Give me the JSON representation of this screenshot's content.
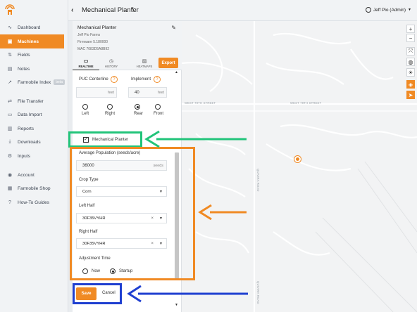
{
  "sidebar": {
    "items": [
      {
        "label": "Dashboard",
        "icon": "pulse-icon"
      },
      {
        "label": "Machines",
        "icon": "machine-icon",
        "active": true
      },
      {
        "label": "Fields",
        "icon": "field-icon"
      },
      {
        "label": "Notes",
        "icon": "notes-icon"
      },
      {
        "label": "Farmobile Index",
        "icon": "index-icon",
        "badge": "beta"
      },
      {
        "label": "File Transfer",
        "icon": "transfer-icon"
      },
      {
        "label": "Data Import",
        "icon": "import-icon"
      },
      {
        "label": "Reports",
        "icon": "reports-icon"
      },
      {
        "label": "Downloads",
        "icon": "download-icon"
      },
      {
        "label": "Inputs",
        "icon": "inputs-icon"
      },
      {
        "label": "Account",
        "icon": "account-icon"
      },
      {
        "label": "Farmobile Shop",
        "icon": "shop-icon"
      },
      {
        "label": "How-To Guides",
        "icon": "help-icon"
      }
    ]
  },
  "header": {
    "title": "Mechanical Planter",
    "user": "Jeff Pio (Admin)"
  },
  "panel": {
    "title": "Mechanical Planter",
    "farm": "Jeff Pio Farms",
    "firmware": "Firmware 5.180000",
    "mac": "MAC 7083D5A8B92",
    "export": "Export",
    "tabs": [
      {
        "label": "REALTIME",
        "icon": "live-icon"
      },
      {
        "label": "HISTORY",
        "icon": "history-icon"
      },
      {
        "label": "HEATMAPS",
        "icon": "heatmap-icon"
      }
    ],
    "puc": {
      "label": "PUC Centerline",
      "value": "",
      "unit": "feet",
      "left": "Left",
      "right": "Right"
    },
    "implement": {
      "label": "Implement",
      "value": "40",
      "unit": "feet",
      "rear": "Rear",
      "front": "Front"
    },
    "checkbox": "Mechanical Planter",
    "population": {
      "label": "Average Population (seeds/acre)",
      "value": "36000",
      "unit": "seeds"
    },
    "crop": {
      "label": "Crop Type",
      "value": "Corn"
    },
    "left_half": {
      "label": "Left Half",
      "value": "30F35VYHR"
    },
    "right_half": {
      "label": "Right Half",
      "value": "30F35VYHR"
    },
    "adjust": {
      "label": "Adjustment Time",
      "now": "Now",
      "startup": "Startup"
    },
    "save": "Save",
    "cancel": "Cancel"
  },
  "map": {
    "road1": "WEST 79TH STREET",
    "road2": "WEST 79TH STREET",
    "road3": "QUIVIRA ROAD",
    "road4": "QUIVIRA ROAD",
    "zoom_in": "+",
    "zoom_out": "−"
  },
  "colors": {
    "accent": "#f08a24",
    "green": "#22c47a",
    "blue": "#1f3fd0"
  }
}
